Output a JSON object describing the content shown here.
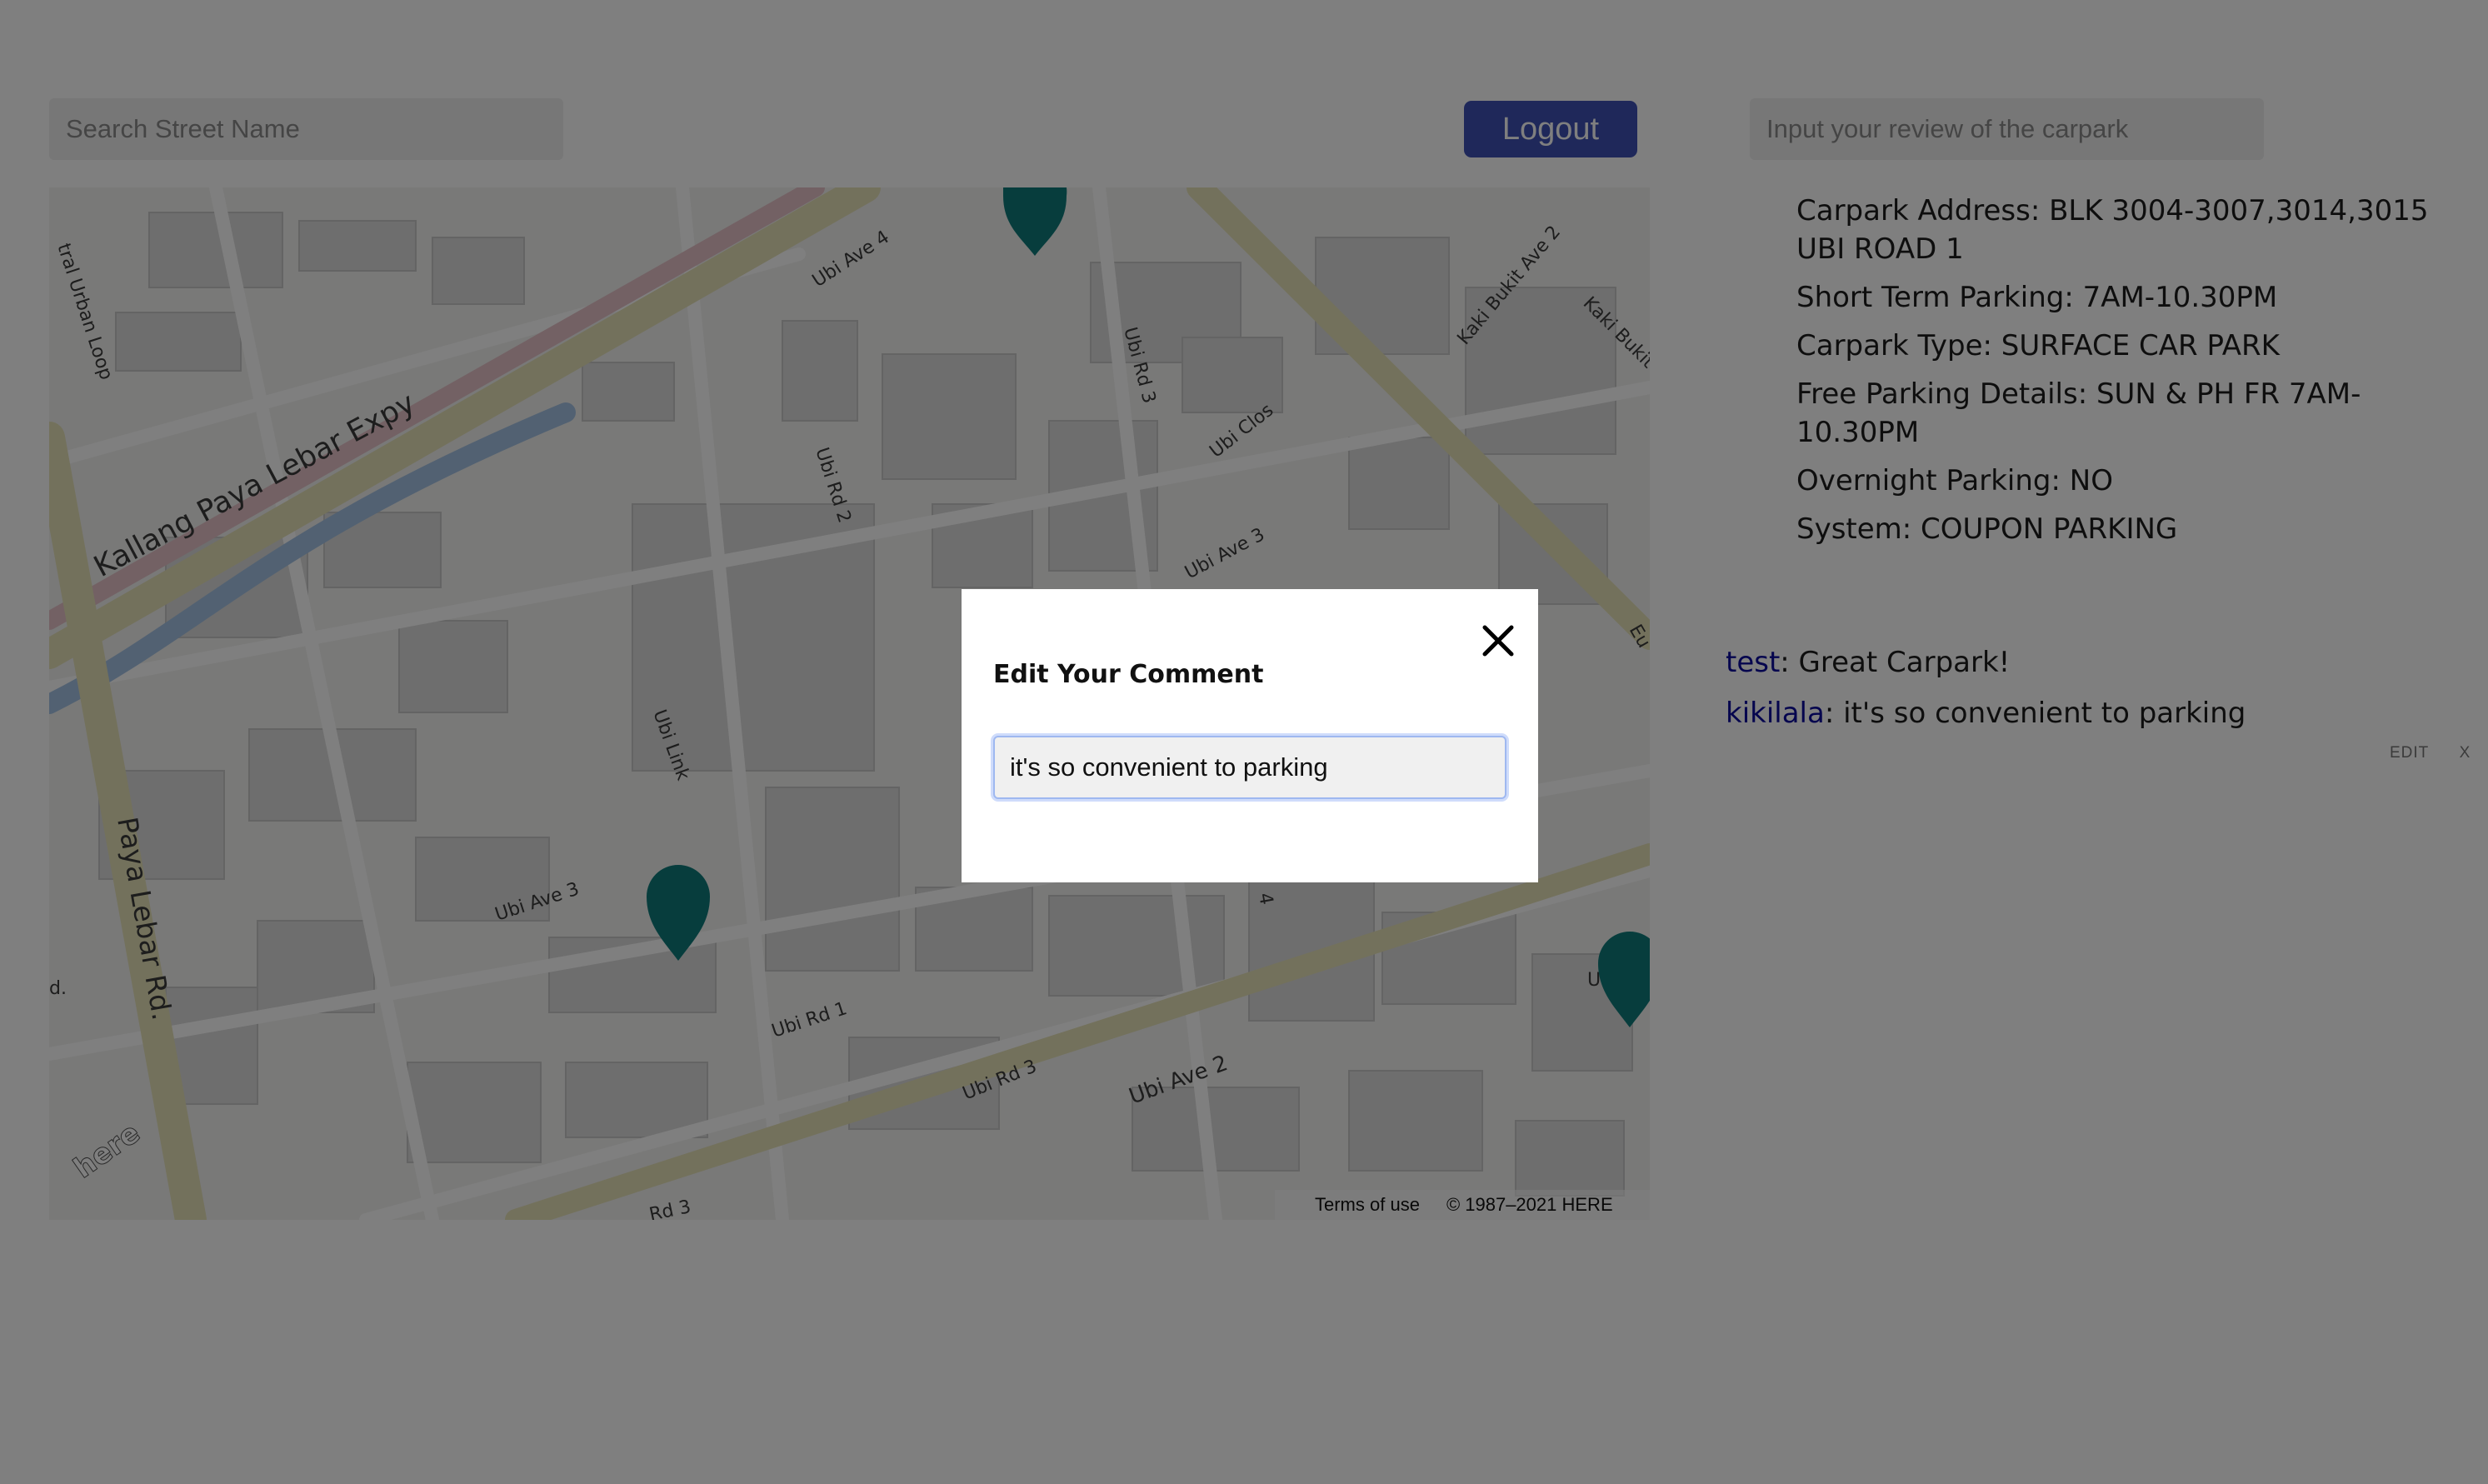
{
  "search": {
    "placeholder": "Search Street Name"
  },
  "header": {
    "logout_label": "Logout"
  },
  "review": {
    "placeholder": "Input your review of the carpark"
  },
  "map": {
    "labels": {
      "urban_loop": "tral Urban Loop",
      "expressway": "Kallang Paya Lebar Expy",
      "paya_lebar_rd": "Paya Lebar Rd.",
      "ubi_ave_4": "Ubi Ave 4",
      "ubi_rd_3_top": "Ubi Rd 3",
      "ubi_rd_2": "Ubi Rd 2",
      "ubi_clos": "Ubi Clos",
      "ubi_ave_3_right": "Ubi Ave 3",
      "kaki_bukit_ave_2": "Kaki Bukit Ave 2",
      "kaki_bukit": "Kaki Bukit",
      "ubi_link": "Ubi Link",
      "ubi_ave_3_left": "Ubi Ave 3",
      "ubi_rd_1": "Ubi Rd 1",
      "ubi_rd_3_bottom": "Ubi Rd 3",
      "ubi_ave_2": "Ubi Ave 2",
      "rd_3_edge": "Rd 3",
      "eu_edge": "Eu",
      "u_edge": "U",
      "d_edge": "d.",
      "four_edge": "4",
      "here_logo": "here"
    },
    "terms": "Terms of use",
    "copyright": "© 1987–2021 HERE",
    "marker_color": "#0f7b7b"
  },
  "carpark": {
    "address": "Carpark Address: BLK 3004-3007,3014,3015 UBI ROAD 1",
    "short_term": "Short Term Parking: 7AM-10.30PM",
    "type": "Carpark Type: SURFACE CAR PARK",
    "free_parking": "Free Parking Details: SUN & PH FR 7AM-10.30PM",
    "overnight": "Overnight Parking: NO",
    "system": "System: COUPON PARKING"
  },
  "comments": [
    {
      "user": "test",
      "text": ": Great Carpark!"
    },
    {
      "user": "kikilala",
      "text": ": it's so convenient to parking",
      "edit_label": "EDIT",
      "delete_label": "X"
    }
  ],
  "modal": {
    "title": "Edit Your Comment",
    "input_value": "it's so convenient to parking",
    "close_icon": "close-icon"
  },
  "colors": {
    "accent": "#3f51b5",
    "username": "#0b0b9c"
  }
}
